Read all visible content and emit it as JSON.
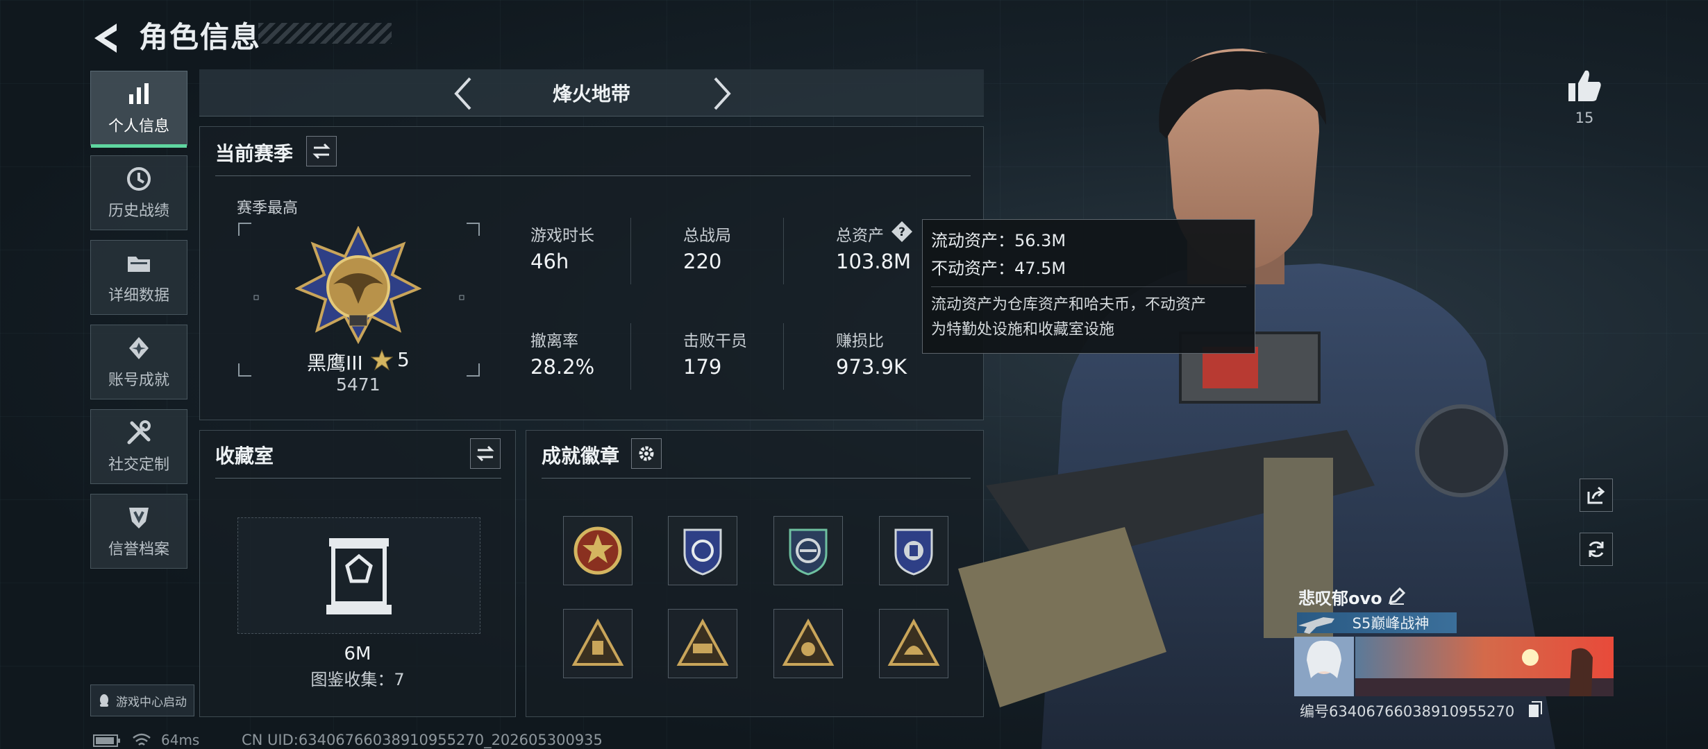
{
  "header": {
    "title": "角色信息"
  },
  "sidebar": {
    "items": [
      {
        "label": "个人信息",
        "icon": "bar-chart-icon",
        "active": true
      },
      {
        "label": "历史战绩",
        "icon": "history-icon"
      },
      {
        "label": "详细数据",
        "icon": "folder-icon"
      },
      {
        "label": "账号成就",
        "icon": "achievement-icon"
      },
      {
        "label": "社交定制",
        "icon": "tools-icon"
      },
      {
        "label": "信誉档案",
        "icon": "shield-badge-icon"
      }
    ],
    "game_center": "游戏中心启动"
  },
  "mode": {
    "name": "烽火地带"
  },
  "season": {
    "title": "当前赛季",
    "best_label": "赛季最高",
    "rank_name": "黑鹰III",
    "stars": "5",
    "score": "5471",
    "stats": [
      {
        "label": "游戏时长",
        "value": "46h"
      },
      {
        "label": "总战局",
        "value": "220"
      },
      {
        "label": "总资产",
        "value": "103.8M"
      },
      {
        "label": "撤离率",
        "value": "28.2%"
      },
      {
        "label": "击败干员",
        "value": "179"
      },
      {
        "label": "赚损比",
        "value": "973.9K"
      }
    ]
  },
  "tooltip": {
    "liquid": "流动资产：56.3M",
    "fixed": "不动资产：47.5M",
    "desc_1": "流动资产为仓库资产和哈夫币，不动资产",
    "desc_2": "为特勤处设施和收藏室设施"
  },
  "collection": {
    "title": "收藏室",
    "value": "6M",
    "count": "图鉴收集：7"
  },
  "badges": {
    "title": "成就徽章"
  },
  "right": {
    "likes": "15",
    "player_name": "悲叹郁ovo",
    "rank_title": "S5巅峰战神",
    "uid": "编号6340676603891095527​0"
  },
  "footer": {
    "ping": "64ms",
    "cn_uid": "CN UID:6340676603891095527​0_202605300935"
  },
  "colors": {
    "accent": "#5fd6a0",
    "rank_bar": "#2a5a84"
  }
}
